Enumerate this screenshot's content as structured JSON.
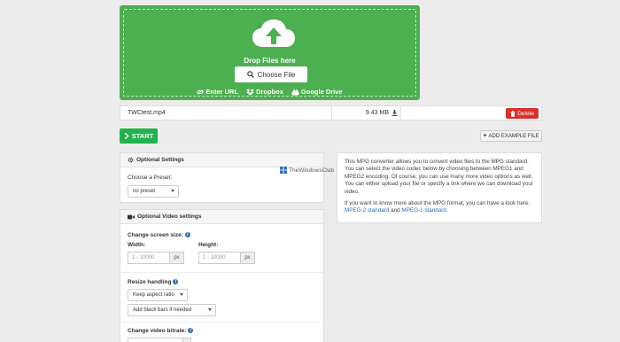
{
  "dropzone": {
    "drop_text": "Drop Files here",
    "choose_label": "Choose File",
    "sources": [
      {
        "label": "Enter URL",
        "icon": "link-icon"
      },
      {
        "label": "Dropbox",
        "icon": "dropbox-icon"
      },
      {
        "label": "Google Drive",
        "icon": "google-drive-icon"
      }
    ]
  },
  "file": {
    "name": "TWCtest.mp4",
    "size": "9.43 MB",
    "delete_label": "Delete"
  },
  "actions": {
    "start_label": "START",
    "example_label": "ADD EXAMPLE FILE"
  },
  "optional_settings": {
    "title": "Optional Settings",
    "preset_label": "Choose a Preset:",
    "preset_value": "no preset"
  },
  "video_settings": {
    "title": "Optional Video settings",
    "screen_size_label": "Change screen size:",
    "width_label": "Width:",
    "height_label": "Height:",
    "width_placeholder": "1 - 10000",
    "height_placeholder": "1 - 10000",
    "unit": "px",
    "resize_label": "Resize handling",
    "resize_value": "Keep aspect ratio",
    "bars_value": "Add black bars if needed",
    "bitrate_label": "Change video bitrate:"
  },
  "description": {
    "para1": "This MPG converter allows you to convert video files to the MPG standard. You can select the video codec below by choosing between MPEG1 and MPEG2 encoding. Of course, you can use many more video options as well. You can either upload your file or specify a link where we can download your video.",
    "para2": "If you want to know more about the MPG format, you can have a look here:",
    "link1": "MPEG-2 standard",
    "and_text": "and",
    "link2": "MPEG-1 standard",
    "end": "."
  },
  "watermark": {
    "text": "TheWindowsClub"
  },
  "colors": {
    "dropzone": "#4caf50",
    "start": "#22b24c",
    "delete": "#d9302c",
    "link": "#2a6db7"
  }
}
